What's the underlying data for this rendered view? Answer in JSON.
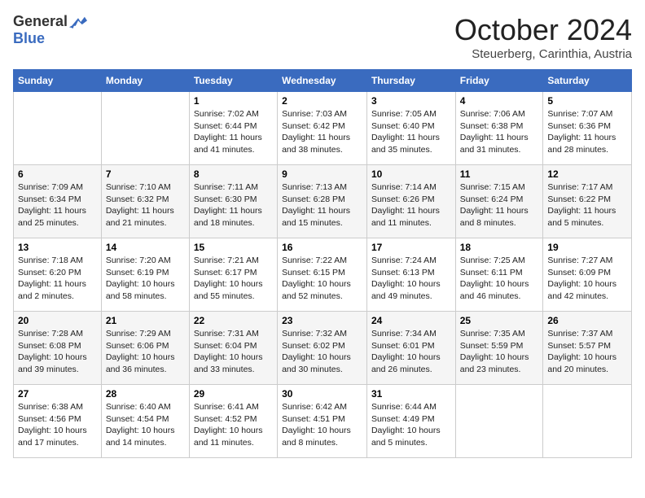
{
  "logo": {
    "general": "General",
    "blue": "Blue"
  },
  "title": "October 2024",
  "location": "Steuerberg, Carinthia, Austria",
  "days_of_week": [
    "Sunday",
    "Monday",
    "Tuesday",
    "Wednesday",
    "Thursday",
    "Friday",
    "Saturday"
  ],
  "weeks": [
    [
      {
        "day": "",
        "sunrise": "",
        "sunset": "",
        "daylight": ""
      },
      {
        "day": "",
        "sunrise": "",
        "sunset": "",
        "daylight": ""
      },
      {
        "day": "1",
        "sunrise": "Sunrise: 7:02 AM",
        "sunset": "Sunset: 6:44 PM",
        "daylight": "Daylight: 11 hours and 41 minutes."
      },
      {
        "day": "2",
        "sunrise": "Sunrise: 7:03 AM",
        "sunset": "Sunset: 6:42 PM",
        "daylight": "Daylight: 11 hours and 38 minutes."
      },
      {
        "day": "3",
        "sunrise": "Sunrise: 7:05 AM",
        "sunset": "Sunset: 6:40 PM",
        "daylight": "Daylight: 11 hours and 35 minutes."
      },
      {
        "day": "4",
        "sunrise": "Sunrise: 7:06 AM",
        "sunset": "Sunset: 6:38 PM",
        "daylight": "Daylight: 11 hours and 31 minutes."
      },
      {
        "day": "5",
        "sunrise": "Sunrise: 7:07 AM",
        "sunset": "Sunset: 6:36 PM",
        "daylight": "Daylight: 11 hours and 28 minutes."
      }
    ],
    [
      {
        "day": "6",
        "sunrise": "Sunrise: 7:09 AM",
        "sunset": "Sunset: 6:34 PM",
        "daylight": "Daylight: 11 hours and 25 minutes."
      },
      {
        "day": "7",
        "sunrise": "Sunrise: 7:10 AM",
        "sunset": "Sunset: 6:32 PM",
        "daylight": "Daylight: 11 hours and 21 minutes."
      },
      {
        "day": "8",
        "sunrise": "Sunrise: 7:11 AM",
        "sunset": "Sunset: 6:30 PM",
        "daylight": "Daylight: 11 hours and 18 minutes."
      },
      {
        "day": "9",
        "sunrise": "Sunrise: 7:13 AM",
        "sunset": "Sunset: 6:28 PM",
        "daylight": "Daylight: 11 hours and 15 minutes."
      },
      {
        "day": "10",
        "sunrise": "Sunrise: 7:14 AM",
        "sunset": "Sunset: 6:26 PM",
        "daylight": "Daylight: 11 hours and 11 minutes."
      },
      {
        "day": "11",
        "sunrise": "Sunrise: 7:15 AM",
        "sunset": "Sunset: 6:24 PM",
        "daylight": "Daylight: 11 hours and 8 minutes."
      },
      {
        "day": "12",
        "sunrise": "Sunrise: 7:17 AM",
        "sunset": "Sunset: 6:22 PM",
        "daylight": "Daylight: 11 hours and 5 minutes."
      }
    ],
    [
      {
        "day": "13",
        "sunrise": "Sunrise: 7:18 AM",
        "sunset": "Sunset: 6:20 PM",
        "daylight": "Daylight: 11 hours and 2 minutes."
      },
      {
        "day": "14",
        "sunrise": "Sunrise: 7:20 AM",
        "sunset": "Sunset: 6:19 PM",
        "daylight": "Daylight: 10 hours and 58 minutes."
      },
      {
        "day": "15",
        "sunrise": "Sunrise: 7:21 AM",
        "sunset": "Sunset: 6:17 PM",
        "daylight": "Daylight: 10 hours and 55 minutes."
      },
      {
        "day": "16",
        "sunrise": "Sunrise: 7:22 AM",
        "sunset": "Sunset: 6:15 PM",
        "daylight": "Daylight: 10 hours and 52 minutes."
      },
      {
        "day": "17",
        "sunrise": "Sunrise: 7:24 AM",
        "sunset": "Sunset: 6:13 PM",
        "daylight": "Daylight: 10 hours and 49 minutes."
      },
      {
        "day": "18",
        "sunrise": "Sunrise: 7:25 AM",
        "sunset": "Sunset: 6:11 PM",
        "daylight": "Daylight: 10 hours and 46 minutes."
      },
      {
        "day": "19",
        "sunrise": "Sunrise: 7:27 AM",
        "sunset": "Sunset: 6:09 PM",
        "daylight": "Daylight: 10 hours and 42 minutes."
      }
    ],
    [
      {
        "day": "20",
        "sunrise": "Sunrise: 7:28 AM",
        "sunset": "Sunset: 6:08 PM",
        "daylight": "Daylight: 10 hours and 39 minutes."
      },
      {
        "day": "21",
        "sunrise": "Sunrise: 7:29 AM",
        "sunset": "Sunset: 6:06 PM",
        "daylight": "Daylight: 10 hours and 36 minutes."
      },
      {
        "day": "22",
        "sunrise": "Sunrise: 7:31 AM",
        "sunset": "Sunset: 6:04 PM",
        "daylight": "Daylight: 10 hours and 33 minutes."
      },
      {
        "day": "23",
        "sunrise": "Sunrise: 7:32 AM",
        "sunset": "Sunset: 6:02 PM",
        "daylight": "Daylight: 10 hours and 30 minutes."
      },
      {
        "day": "24",
        "sunrise": "Sunrise: 7:34 AM",
        "sunset": "Sunset: 6:01 PM",
        "daylight": "Daylight: 10 hours and 26 minutes."
      },
      {
        "day": "25",
        "sunrise": "Sunrise: 7:35 AM",
        "sunset": "Sunset: 5:59 PM",
        "daylight": "Daylight: 10 hours and 23 minutes."
      },
      {
        "day": "26",
        "sunrise": "Sunrise: 7:37 AM",
        "sunset": "Sunset: 5:57 PM",
        "daylight": "Daylight: 10 hours and 20 minutes."
      }
    ],
    [
      {
        "day": "27",
        "sunrise": "Sunrise: 6:38 AM",
        "sunset": "Sunset: 4:56 PM",
        "daylight": "Daylight: 10 hours and 17 minutes."
      },
      {
        "day": "28",
        "sunrise": "Sunrise: 6:40 AM",
        "sunset": "Sunset: 4:54 PM",
        "daylight": "Daylight: 10 hours and 14 minutes."
      },
      {
        "day": "29",
        "sunrise": "Sunrise: 6:41 AM",
        "sunset": "Sunset: 4:52 PM",
        "daylight": "Daylight: 10 hours and 11 minutes."
      },
      {
        "day": "30",
        "sunrise": "Sunrise: 6:42 AM",
        "sunset": "Sunset: 4:51 PM",
        "daylight": "Daylight: 10 hours and 8 minutes."
      },
      {
        "day": "31",
        "sunrise": "Sunrise: 6:44 AM",
        "sunset": "Sunset: 4:49 PM",
        "daylight": "Daylight: 10 hours and 5 minutes."
      },
      {
        "day": "",
        "sunrise": "",
        "sunset": "",
        "daylight": ""
      },
      {
        "day": "",
        "sunrise": "",
        "sunset": "",
        "daylight": ""
      }
    ]
  ]
}
